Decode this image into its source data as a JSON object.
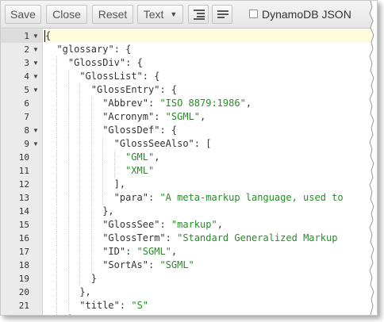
{
  "toolbar": {
    "save_label": "Save",
    "close_label": "Close",
    "reset_label": "Reset",
    "mode_label": "Text",
    "format_icon": "indent-format-icon",
    "compact_icon": "compact-format-icon",
    "dynamodb_label": "DynamoDB JSON",
    "dynamodb_checked": false
  },
  "editor": {
    "active_line": 1,
    "lines": [
      {
        "n": "1",
        "fold": true,
        "indent": 0,
        "tokens": [
          {
            "t": "p",
            "v": "{"
          }
        ]
      },
      {
        "n": "2",
        "fold": true,
        "indent": 1,
        "tokens": [
          {
            "t": "k",
            "v": "\"glossary\""
          },
          {
            "t": "p",
            "v": ": {"
          }
        ]
      },
      {
        "n": "3",
        "fold": true,
        "indent": 2,
        "tokens": [
          {
            "t": "k",
            "v": "\"GlossDiv\""
          },
          {
            "t": "p",
            "v": ": {"
          }
        ]
      },
      {
        "n": "4",
        "fold": true,
        "indent": 3,
        "tokens": [
          {
            "t": "k",
            "v": "\"GlossList\""
          },
          {
            "t": "p",
            "v": ": {"
          }
        ]
      },
      {
        "n": "5",
        "fold": true,
        "indent": 4,
        "tokens": [
          {
            "t": "k",
            "v": "\"GlossEntry\""
          },
          {
            "t": "p",
            "v": ": {"
          }
        ]
      },
      {
        "n": "6",
        "fold": false,
        "indent": 5,
        "tokens": [
          {
            "t": "k",
            "v": "\"Abbrev\""
          },
          {
            "t": "p",
            "v": ": "
          },
          {
            "t": "s",
            "v": "\"ISO 8879:1986\""
          },
          {
            "t": "p",
            "v": ","
          }
        ]
      },
      {
        "n": "7",
        "fold": false,
        "indent": 5,
        "tokens": [
          {
            "t": "k",
            "v": "\"Acronym\""
          },
          {
            "t": "p",
            "v": ": "
          },
          {
            "t": "s",
            "v": "\"SGML\""
          },
          {
            "t": "p",
            "v": ","
          }
        ]
      },
      {
        "n": "8",
        "fold": true,
        "indent": 5,
        "tokens": [
          {
            "t": "k",
            "v": "\"GlossDef\""
          },
          {
            "t": "p",
            "v": ": {"
          }
        ]
      },
      {
        "n": "9",
        "fold": true,
        "indent": 6,
        "tokens": [
          {
            "t": "k",
            "v": "\"GlossSeeAlso\""
          },
          {
            "t": "p",
            "v": ": ["
          }
        ]
      },
      {
        "n": "10",
        "fold": false,
        "indent": 7,
        "tokens": [
          {
            "t": "s",
            "v": "\"GML\""
          },
          {
            "t": "p",
            "v": ","
          }
        ]
      },
      {
        "n": "11",
        "fold": false,
        "indent": 7,
        "tokens": [
          {
            "t": "s",
            "v": "\"XML\""
          }
        ]
      },
      {
        "n": "12",
        "fold": false,
        "indent": 6,
        "tokens": [
          {
            "t": "p",
            "v": "],"
          }
        ]
      },
      {
        "n": "13",
        "fold": false,
        "indent": 6,
        "tokens": [
          {
            "t": "k",
            "v": "\"para\""
          },
          {
            "t": "p",
            "v": ": "
          },
          {
            "t": "s",
            "v": "\"A meta-markup language, used to"
          }
        ]
      },
      {
        "n": "14",
        "fold": false,
        "indent": 5,
        "tokens": [
          {
            "t": "p",
            "v": "},"
          }
        ]
      },
      {
        "n": "15",
        "fold": false,
        "indent": 5,
        "tokens": [
          {
            "t": "k",
            "v": "\"GlossSee\""
          },
          {
            "t": "p",
            "v": ": "
          },
          {
            "t": "s",
            "v": "\"markup\""
          },
          {
            "t": "p",
            "v": ","
          }
        ]
      },
      {
        "n": "16",
        "fold": false,
        "indent": 5,
        "tokens": [
          {
            "t": "k",
            "v": "\"GlossTerm\""
          },
          {
            "t": "p",
            "v": ": "
          },
          {
            "t": "s",
            "v": "\"Standard Generalized Markup"
          }
        ]
      },
      {
        "n": "17",
        "fold": false,
        "indent": 5,
        "tokens": [
          {
            "t": "k",
            "v": "\"ID\""
          },
          {
            "t": "p",
            "v": ": "
          },
          {
            "t": "s",
            "v": "\"SGML\""
          },
          {
            "t": "p",
            "v": ","
          }
        ]
      },
      {
        "n": "18",
        "fold": false,
        "indent": 5,
        "tokens": [
          {
            "t": "k",
            "v": "\"SortAs\""
          },
          {
            "t": "p",
            "v": ": "
          },
          {
            "t": "s",
            "v": "\"SGML\""
          }
        ]
      },
      {
        "n": "19",
        "fold": false,
        "indent": 4,
        "tokens": [
          {
            "t": "p",
            "v": "}"
          }
        ]
      },
      {
        "n": "20",
        "fold": false,
        "indent": 3,
        "tokens": [
          {
            "t": "p",
            "v": "},"
          }
        ]
      },
      {
        "n": "21",
        "fold": false,
        "indent": 3,
        "tokens": [
          {
            "t": "k",
            "v": "\"title\""
          },
          {
            "t": "p",
            "v": ": "
          },
          {
            "t": "s",
            "v": "\"S\""
          }
        ]
      },
      {
        "n": "22",
        "fold": false,
        "indent": 2,
        "tokens": [
          {
            "t": "p",
            "v": "},"
          }
        ]
      }
    ]
  },
  "colors": {
    "key": "#333333",
    "string": "#2a8a2a",
    "active_line_bg": "#fffbdd",
    "gutter_bg": "#ebebeb"
  }
}
